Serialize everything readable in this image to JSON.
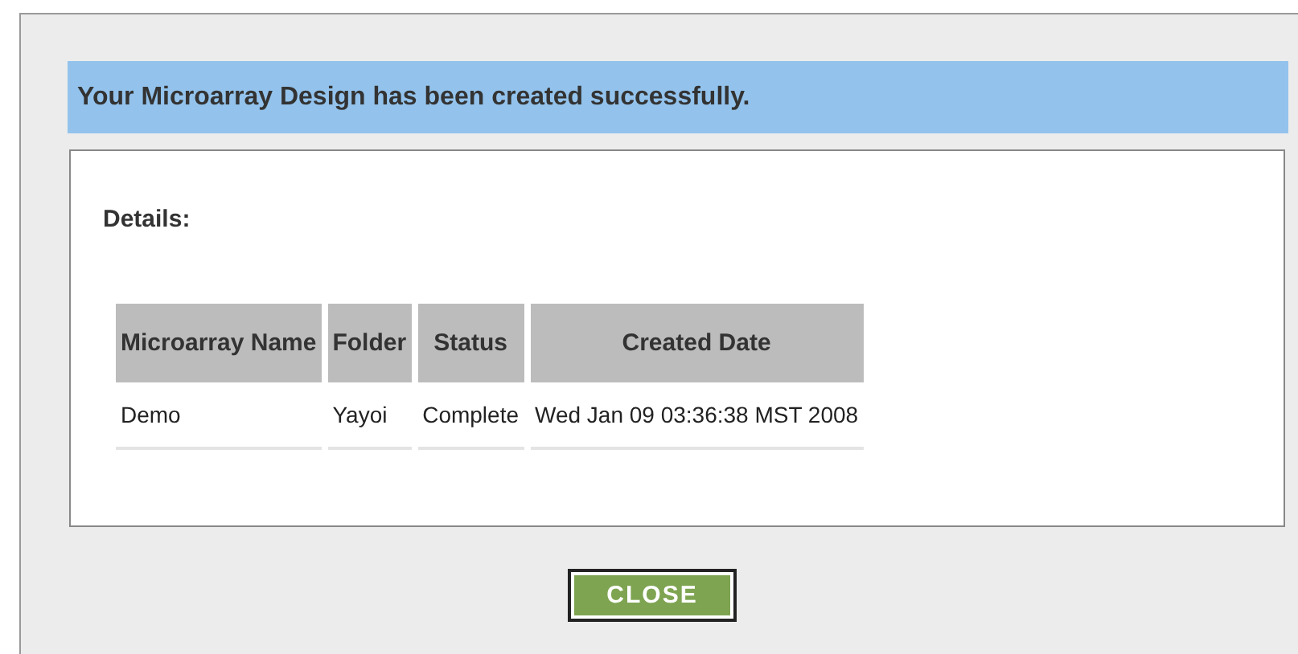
{
  "banner": "Your Microarray Design has been created successfully.",
  "details": {
    "heading": "Details:",
    "table": {
      "columns": [
        "Microarray Name",
        "Folder",
        "Status",
        "Created Date"
      ],
      "rows": [
        [
          "Demo",
          "Yayoi",
          "Complete",
          "Wed Jan 09 03:36:38 MST 2008"
        ]
      ]
    }
  },
  "buttons": [
    "CLOSE"
  ]
}
